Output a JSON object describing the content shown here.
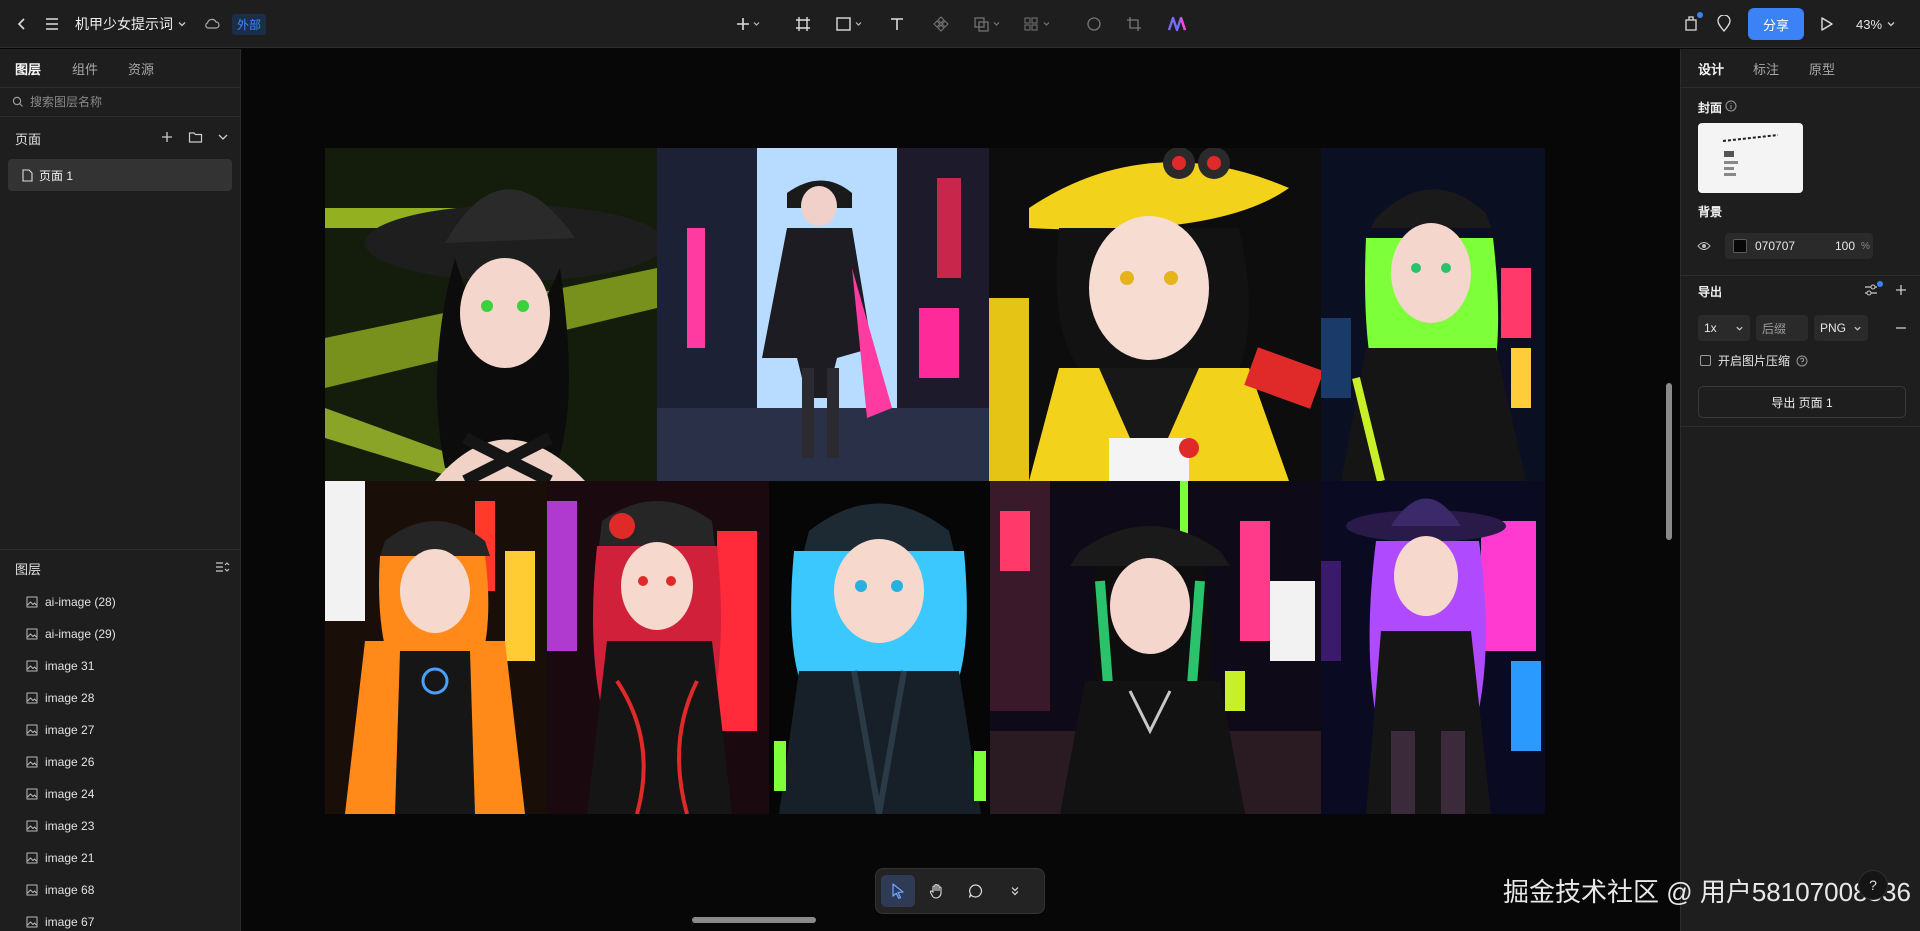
{
  "header": {
    "project_title": "机甲少女提示词",
    "external_badge": "外部",
    "share_label": "分享",
    "zoom_level": "43%"
  },
  "left_panel": {
    "tabs": [
      {
        "label": "图层",
        "active": true
      },
      {
        "label": "组件",
        "active": false
      },
      {
        "label": "资源",
        "active": false
      }
    ],
    "search_placeholder": "搜索图层名称",
    "pages_header": "页面",
    "pages": [
      {
        "label": "页面 1",
        "selected": true
      }
    ],
    "layers_header": "图层",
    "layers": [
      {
        "label": "ai-image (28)"
      },
      {
        "label": "ai-image (29)"
      },
      {
        "label": "image 31"
      },
      {
        "label": "image 28"
      },
      {
        "label": "image 27"
      },
      {
        "label": "image 26"
      },
      {
        "label": "image 24"
      },
      {
        "label": "image 23"
      },
      {
        "label": "image 21"
      },
      {
        "label": "image 68"
      },
      {
        "label": "image 67"
      }
    ]
  },
  "right_panel": {
    "tabs": [
      {
        "label": "设计",
        "active": true
      },
      {
        "label": "标注",
        "active": false
      },
      {
        "label": "原型",
        "active": false
      }
    ],
    "cover_label": "封面",
    "background_label": "背景",
    "background_hex": "070707",
    "background_opacity": "100",
    "background_opacity_unit": "%",
    "export_label": "导出",
    "export_scale": "1x",
    "export_suffix_placeholder": "后缀",
    "export_format": "PNG",
    "compress_label": "开启图片压缩",
    "export_button_label": "导出 页面 1"
  },
  "canvas": {
    "background_color": "#070707",
    "artworks": [
      {
        "name": "girl-green-hair-witch-hat",
        "palette": [
          "#1a2a10",
          "#d8ff3a",
          "#2a2a2a"
        ]
      },
      {
        "name": "girl-city-street-night",
        "palette": [
          "#9fd0ff",
          "#1a1d2e",
          "#ff3aa0"
        ]
      },
      {
        "name": "girl-yellow-helmet",
        "palette": [
          "#101010",
          "#f2d21a",
          "#2a2a2a"
        ]
      },
      {
        "name": "girl-green-hair-cap",
        "palette": [
          "#0b0f22",
          "#7dff3a",
          "#1a1a1a"
        ]
      },
      {
        "name": "girl-orange-jacket",
        "palette": [
          "#1a0f08",
          "#ff8a1a",
          "#ffcc33"
        ]
      },
      {
        "name": "girl-red-hair-mech-cap",
        "palette": [
          "#1a0a0f",
          "#ff2a3a",
          "#202020"
        ]
      },
      {
        "name": "girl-blue-hair-cap",
        "palette": [
          "#0a0a0a",
          "#3ac8ff",
          "#1c2a33"
        ]
      },
      {
        "name": "girl-green-black-city",
        "palette": [
          "#0f0a18",
          "#ff3a6a",
          "#7dff3a"
        ]
      },
      {
        "name": "girl-purple-hair-hat",
        "palette": [
          "#0a0a22",
          "#b04aff",
          "#ff3ad0"
        ]
      }
    ]
  },
  "bottom_toolbar": {
    "tools": [
      {
        "name": "select-tool",
        "active": true
      },
      {
        "name": "hand-tool",
        "active": false
      },
      {
        "name": "comment-tool",
        "active": false
      },
      {
        "name": "more-tools",
        "active": false
      }
    ]
  },
  "watermark": "掘金技术社区 @ 用户58107008336",
  "colors": {
    "accent": "#3b82f6",
    "panel": "#1e1e1e",
    "canvas": "#070707"
  }
}
